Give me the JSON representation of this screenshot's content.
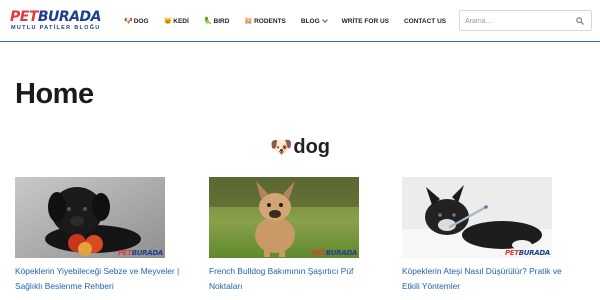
{
  "logo": {
    "part1": "PET",
    "part2": "BURADA",
    "tagline": "MUTLU PATİLER BLOĞU"
  },
  "nav": {
    "items": [
      {
        "emoji": "🐶",
        "label": "DOG"
      },
      {
        "emoji": "😺",
        "label": "KEDİ"
      },
      {
        "emoji": "🦜",
        "label": "BIRD"
      },
      {
        "emoji": "🐹",
        "label": "RODENTS"
      },
      {
        "emoji": "",
        "label": "BLOG"
      },
      {
        "emoji": "",
        "label": "WRİTE FOR US"
      },
      {
        "emoji": "",
        "label": "CONTACT US"
      }
    ]
  },
  "search": {
    "placeholder": "Arama…",
    "value": ""
  },
  "main": {
    "page_title": "Home",
    "section": {
      "emoji": "🐶",
      "title": "dog"
    },
    "posts": [
      {
        "title": "Köpeklerin Yiyebileceği Sebze ve Meyveler | Sağlıklı Beslenme Rehberi"
      },
      {
        "title": "French Bulldog Bakımının Şaşırtıcı Püf Noktaları"
      },
      {
        "title": "Köpeklerin Ateşi Nasıl Düşürülür? Pratik ve Etkili Yöntemler"
      }
    ]
  },
  "colors": {
    "accent": "#1e3f8f",
    "logo_red": "#e23a3a",
    "link": "#1e63b5",
    "header_border": "#3d6ea3"
  }
}
